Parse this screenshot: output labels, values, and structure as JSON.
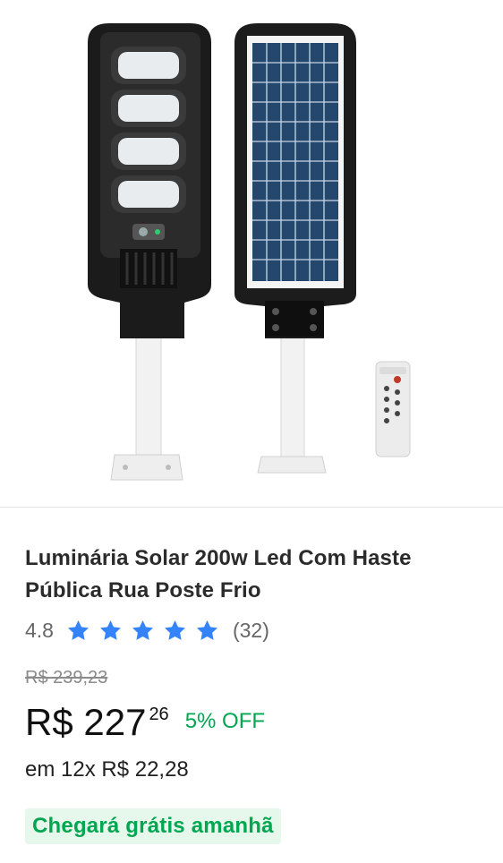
{
  "product": {
    "title": "Luminária Solar 200w Led Com Haste Pública Rua Poste Frio",
    "image_alt": "Luminária solar com painel e controle remoto"
  },
  "rating": {
    "value": "4.8",
    "stars": 5,
    "count": "(32)",
    "star_color": "#3483fa"
  },
  "price": {
    "old": "R$ 239,23",
    "currency_main": "R$ 227",
    "cents": "26",
    "discount": "5% OFF"
  },
  "installments": "em 12x R$ 22,28",
  "shipping": {
    "text": "Chegará grátis amanhã",
    "color": "#00a650"
  }
}
